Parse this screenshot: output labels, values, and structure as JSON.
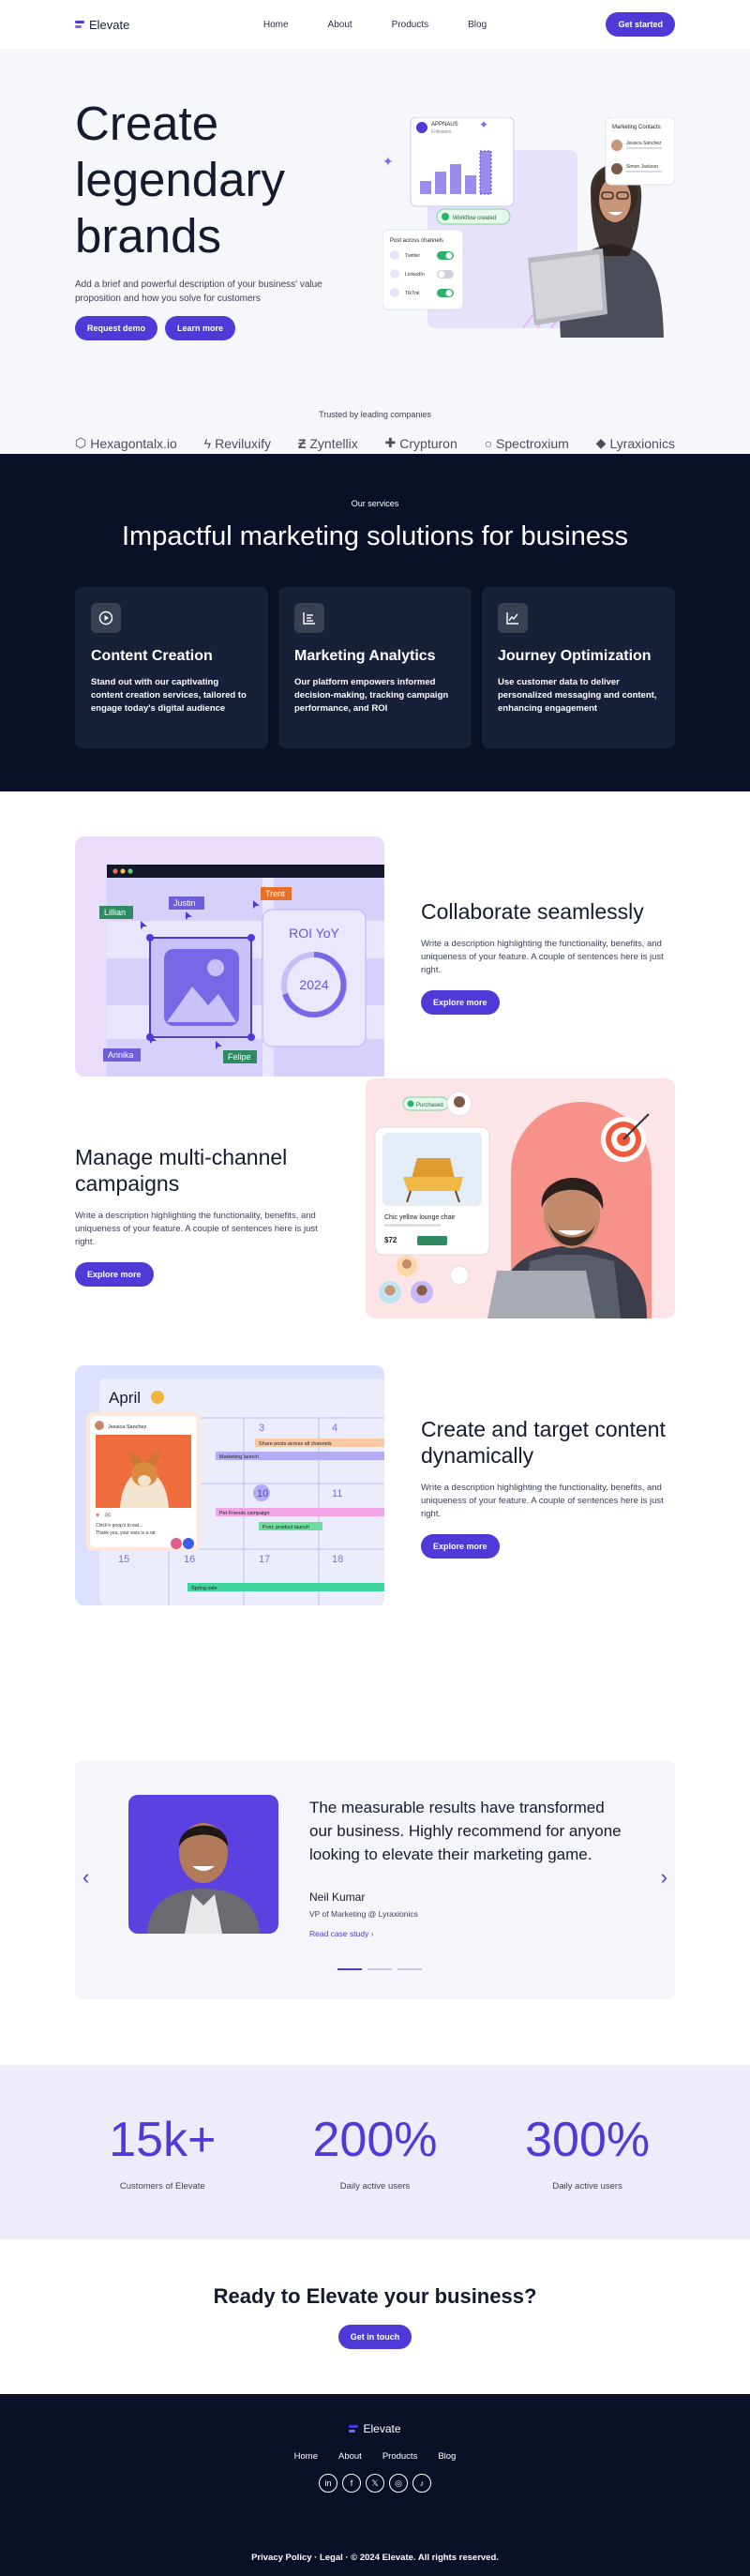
{
  "nav": {
    "logo": "Elevate",
    "links": [
      "Home",
      "About",
      "Products",
      "Blog"
    ],
    "cta": "Get started"
  },
  "hero": {
    "title": "Create legendary brands",
    "description": "Add a brief and powerful description of your business' value proposition and how you solve for customers",
    "primary_button": "Request demo",
    "secondary_button": "Learn more",
    "art": {
      "stats_card_title": "APPNAUS",
      "stats_card_sub": "Followers",
      "workflow_badge": "Workflow created",
      "channels_title": "Post across channels",
      "channels": [
        "Twitter",
        "LinkedIn",
        "TikTok"
      ],
      "contacts_title": "Marketing Contacts",
      "contacts": [
        "Jessica Sanchez",
        "Simon Jackson"
      ]
    }
  },
  "trusted": {
    "label": "Trusted by leading companies",
    "logos": [
      "Hexagontalx.io",
      "Reviluxify",
      "Zyntellix",
      "Crypturon",
      "Spectroxium",
      "Lyraxionics"
    ]
  },
  "services": {
    "eyebrow": "Our services",
    "title": "Impactful marketing solutions for business",
    "cards": [
      {
        "icon": "play-circle-icon",
        "title": "Content Creation",
        "text": "Stand out with our captivating content creation services, tailored to engage today's digital audience"
      },
      {
        "icon": "list-chart-icon",
        "title": "Marketing Analytics",
        "text": "Our platform empowers informed decision-making, tracking campaign performance, and ROI"
      },
      {
        "icon": "line-chart-icon",
        "title": "Journey Optimization",
        "text": "Use customer data to deliver personalized messaging and content, enhancing engagement"
      }
    ]
  },
  "features": [
    {
      "title": "Collaborate seamlessly",
      "text": "Write a description highlighting the functionality, benefits, and uniqueness of your feature. A couple of sentences here is just right.",
      "button": "Explore more",
      "art": {
        "tags": [
          "Justin",
          "Trent",
          "Lillian",
          "Annika",
          "Felipe"
        ],
        "roi_label": "ROI YoY",
        "roi_year": "2024"
      }
    },
    {
      "title": "Manage multi-channel campaigns",
      "text": "Write a description highlighting the functionality, benefits, and uniqueness of your feature. A couple of sentences here is just right.",
      "button": "Explore more",
      "art": {
        "product": "Chic yellow lounge chair",
        "price": "$72",
        "badge": "Purchased"
      }
    },
    {
      "title": "Create and target content dynamically",
      "text": "Write a description highlighting the functionality, benefits, and uniqueness of your feature. A couple of sentences here is just right.",
      "button": "Explore more",
      "art": {
        "month": "April",
        "days": [
          "3",
          "4",
          "10",
          "11",
          "15",
          "16",
          "17",
          "18"
        ],
        "events": [
          "Share posts across all channels",
          "Marketing launch",
          "Pet Friends campaign",
          "Post: product launch",
          "Spring sale"
        ],
        "post_author": "Jessica Sanchez",
        "post_caption": "Chick'n poop's to eat...",
        "post_reply": "Thank you, your ears is a rat"
      }
    }
  ],
  "testimonial": {
    "quote": "The measurable results have transformed our business. Highly recommend for anyone looking to elevate their marketing game.",
    "name": "Neil Kumar",
    "role": "VP of Marketing @ Lyraxionics",
    "link": "Read case study"
  },
  "stats": [
    {
      "value": "15k+",
      "label": "Customers of Elevate"
    },
    {
      "value": "200%",
      "label": "Daily active users"
    },
    {
      "value": "300%",
      "label": "Daily active users"
    }
  ],
  "cta": {
    "title": "Ready to Elevate your business?",
    "button": "Get in touch"
  },
  "footer": {
    "logo": "Elevate",
    "links": [
      "Home",
      "About",
      "Products",
      "Blog"
    ],
    "legal": "Privacy Policy · Legal · © 2024 Elevate. All rights reserved."
  },
  "colors": {
    "accent": "#4f3ad8",
    "dark": "#0b1029",
    "card": "#182039",
    "hero_bg": "#f6f7fb",
    "stats_bg": "#eeecfa"
  }
}
